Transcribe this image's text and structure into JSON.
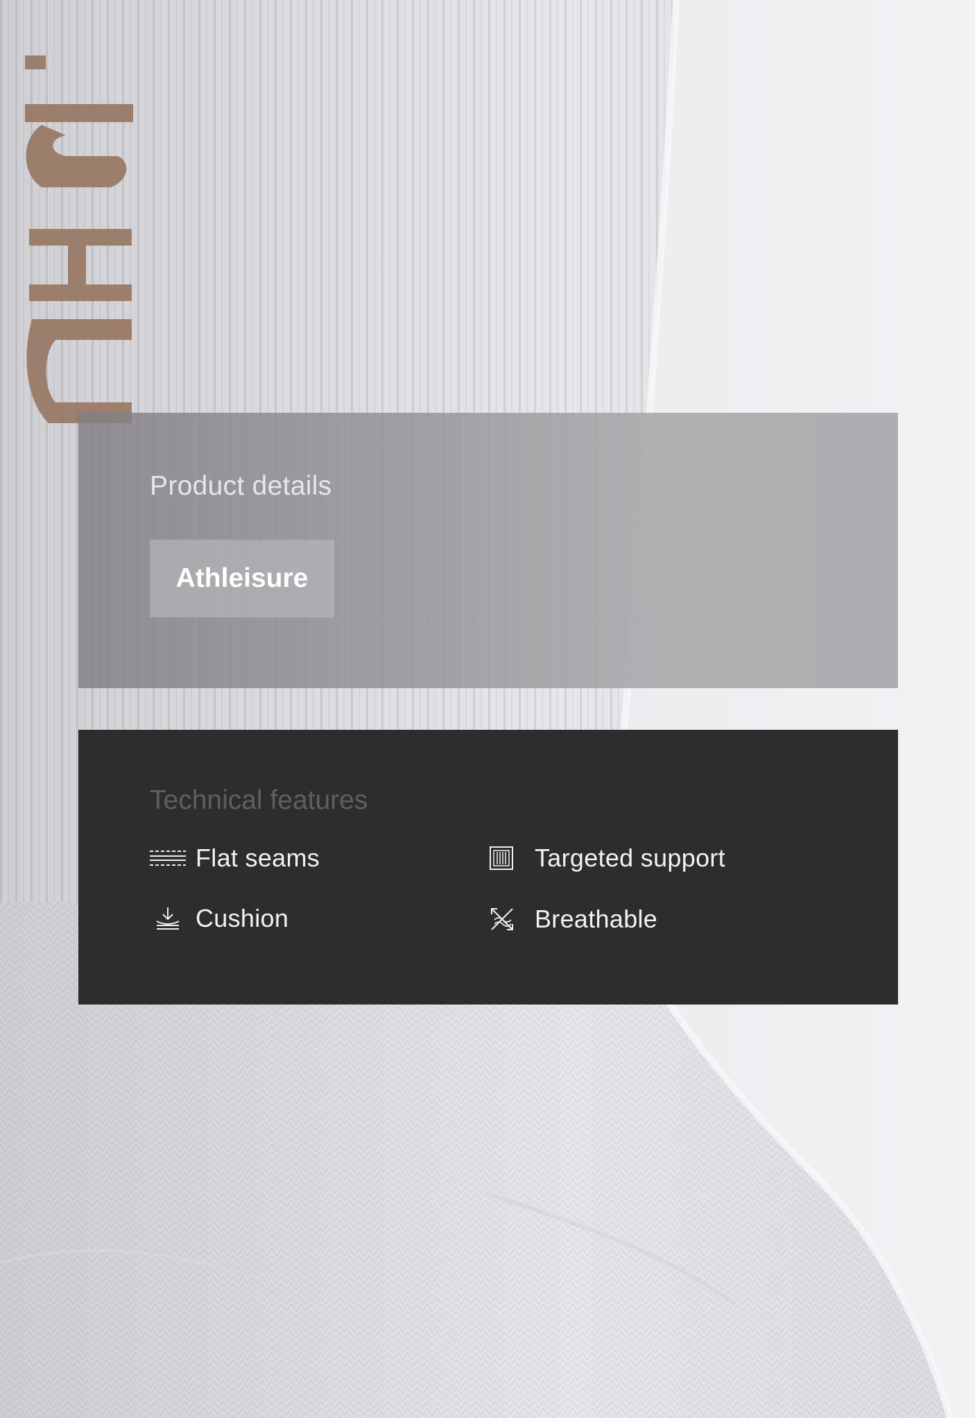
{
  "product_details": {
    "title": "Product details",
    "tag": "Athleisure"
  },
  "technical_features": {
    "title": "Technical features",
    "items": [
      {
        "label": "Flat seams",
        "icon": "flat-seams-icon"
      },
      {
        "label": "Targeted support",
        "icon": "targeted-support-icon"
      },
      {
        "label": "Cushion",
        "icon": "cushion-icon"
      },
      {
        "label": "Breathable",
        "icon": "breathable-icon"
      }
    ]
  },
  "colors": {
    "details_panel": "#a6a6a9",
    "features_panel": "#2d2d2d",
    "logo_knit": "#9a7a68",
    "sock": "#e9e8ec"
  }
}
